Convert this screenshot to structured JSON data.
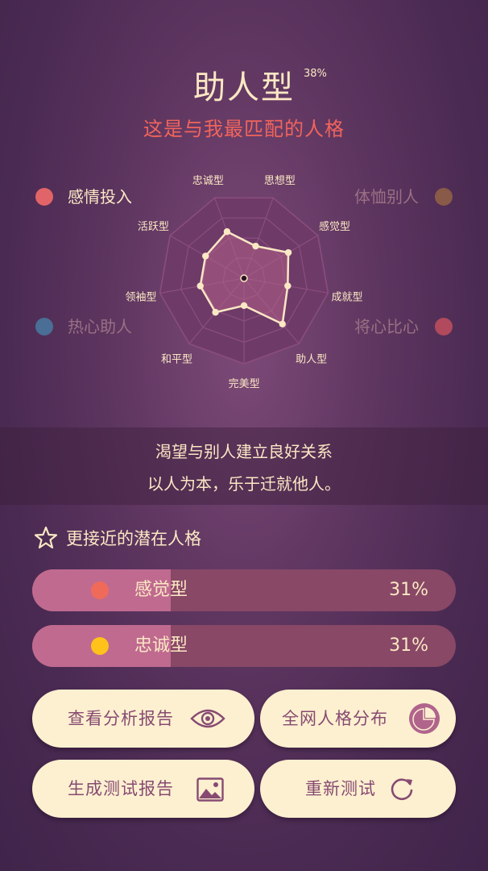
{
  "header": {
    "title": "助人型",
    "title_percent": "38%",
    "subtitle": "这是与我最匹配的人格"
  },
  "legend": [
    {
      "label": "感情投入",
      "color": "#e06468"
    },
    {
      "label": "体恤别人",
      "color": "#8a5a48"
    },
    {
      "label": "热心助人",
      "color": "#4a6e96"
    },
    {
      "label": "将心比心",
      "color": "#b04a5c"
    }
  ],
  "chart_data": {
    "type": "radar",
    "categories": [
      "忠诚型",
      "思想型",
      "感觉型",
      "成就型",
      "助人型",
      "完美型",
      "和平型",
      "领袖型",
      "活跃型"
    ],
    "values": [
      0.58,
      0.4,
      0.6,
      0.52,
      0.7,
      0.32,
      0.52,
      0.52,
      0.52
    ],
    "max": 1,
    "rings": 4,
    "colors": {
      "fill": "#b26088",
      "line": "#fbe8c4",
      "grid": "#8a4e7e",
      "bg": "#6e3a68"
    }
  },
  "description": {
    "line1": "渴望与别人建立良好关系",
    "line2": "以人为本，乐于迁就他人。"
  },
  "potential": {
    "title": "更接近的潜在人格",
    "icon": "star-icon",
    "items": [
      {
        "label": "感觉型",
        "percent": "31%",
        "value": 0.31,
        "dot_color": "#f06a5a"
      },
      {
        "label": "忠诚型",
        "percent": "31%",
        "value": 0.31,
        "dot_color": "#ffc21a"
      }
    ]
  },
  "buttons": {
    "view_report": {
      "label": "查看分析报告",
      "icon": "eye-icon"
    },
    "distribution": {
      "label": "全网人格分布",
      "icon": "pie-chart-icon"
    },
    "generate_report": {
      "label": "生成测试报告",
      "icon": "image-icon"
    },
    "retest": {
      "label": "重新测试",
      "icon": "refresh-icon"
    }
  },
  "colors": {
    "cream": "#fbe8c4",
    "accent_red": "#f0645c",
    "button_text": "#874a72"
  }
}
